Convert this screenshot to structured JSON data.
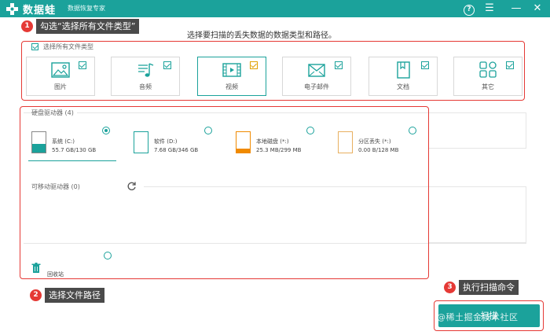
{
  "app": {
    "name": "数据蛙",
    "subtitle": "数据恢复专家",
    "help_glyph": "?",
    "menu_glyph": "☰",
    "min_glyph": "—",
    "close_glyph": "✕"
  },
  "callouts": [
    {
      "num": "1",
      "label": "勾选“选择所有文件类型”"
    },
    {
      "num": "2",
      "label": "选择文件路径"
    },
    {
      "num": "3",
      "label": "执行扫描命令"
    }
  ],
  "instruction": "选择要扫描的丢失数据的数据类型和路径。",
  "file_types": {
    "select_all_label": "选择所有文件类型",
    "items": [
      {
        "label": "图片",
        "icon": "image-icon"
      },
      {
        "label": "音频",
        "icon": "music-icon"
      },
      {
        "label": "视频",
        "icon": "video-icon"
      },
      {
        "label": "电子邮件",
        "icon": "email-icon"
      },
      {
        "label": "文档",
        "icon": "document-icon"
      },
      {
        "label": "其它",
        "icon": "other-icon"
      }
    ]
  },
  "drives": {
    "hdd_title": "硬盘驱动器 (4)",
    "items": [
      {
        "name": "系统 (C:)",
        "size": "55.7 GB/130 GB",
        "selected": true
      },
      {
        "name": "软件 (D:)",
        "size": "7.68 GB/346 GB",
        "selected": false
      },
      {
        "name": "本地磁盘 (*:)",
        "size": "25.3 MB/299 MB",
        "selected": false
      },
      {
        "name": "分区丢失 (*:)",
        "size": "0.00  B/128 MB",
        "selected": false
      }
    ],
    "removable_title": "可移动驱动器 (0)",
    "recycle_label": "回收站"
  },
  "scan_button": {
    "label": "扫描"
  },
  "watermark": "@稀土掘金技术社区",
  "colors": {
    "brand": "#1ba29b",
    "callout_red": "#e53935",
    "callout_bg": "#4a4a4a",
    "video_check": "#e0a000",
    "drive_fill_system": "#1ba29b",
    "drive_fill_local": "#f08a00"
  }
}
